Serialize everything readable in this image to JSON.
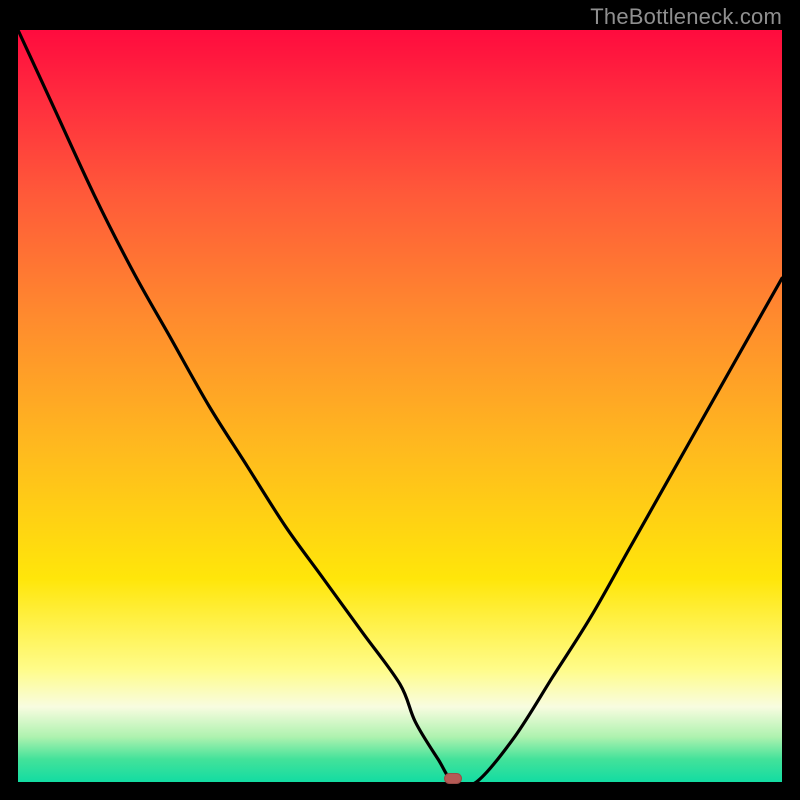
{
  "watermark": "TheBottleneck.com",
  "colors": {
    "frame": "#000000",
    "gradient_top": "#ff0b3e",
    "gradient_bottom": "#13dca2",
    "curve": "#000000",
    "marker": "#b55a55"
  },
  "chart_data": {
    "type": "line",
    "title": "",
    "xlabel": "",
    "ylabel": "",
    "xlim": [
      0,
      100
    ],
    "ylim": [
      0,
      100
    ],
    "x": [
      0,
      5,
      10,
      15,
      20,
      25,
      30,
      35,
      40,
      45,
      50,
      52,
      55,
      57,
      60,
      65,
      70,
      75,
      80,
      85,
      90,
      95,
      100
    ],
    "values": [
      100,
      89,
      78,
      68,
      59,
      50,
      42,
      34,
      27,
      20,
      13,
      8,
      3,
      0,
      0,
      6,
      14,
      22,
      31,
      40,
      49,
      58,
      67
    ],
    "marker": {
      "x": 57,
      "y": 0
    },
    "notes": "x and y are percentages of the inner plot area; no axis ticks or labels are rendered in the image."
  }
}
